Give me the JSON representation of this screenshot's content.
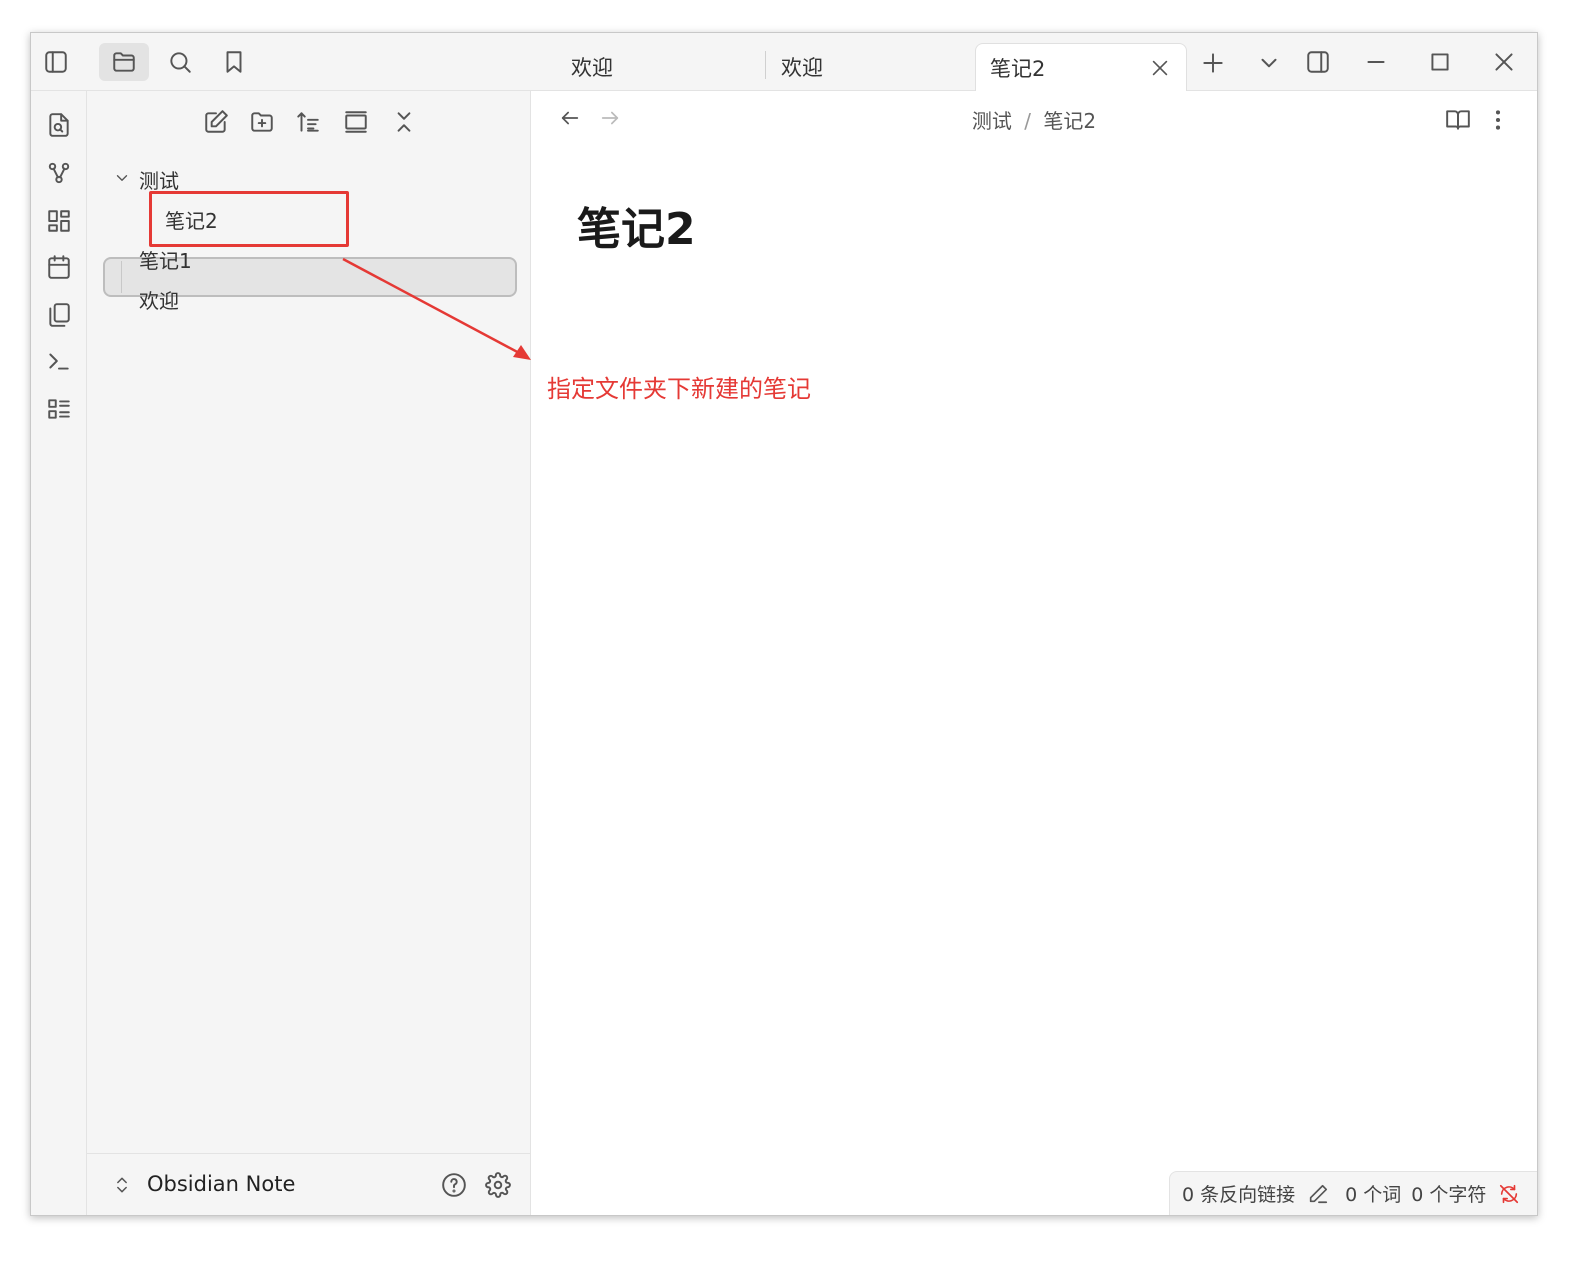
{
  "ribbon": {
    "icons": [
      "file-search-icon",
      "graph-icon",
      "grid-icon",
      "calendar-icon",
      "copy-icon",
      "terminal-icon",
      "list-icon"
    ]
  },
  "sidebar_header": {
    "icons": [
      "sidebar-toggle-icon",
      "folder-icon",
      "search-icon",
      "bookmark-icon"
    ]
  },
  "file_explorer": {
    "toolbar_icons": [
      "new-note-icon",
      "new-folder-icon",
      "sort-icon",
      "collapse-view-icon",
      "collapse-all-icon"
    ],
    "folder": {
      "label": "测试"
    },
    "items": [
      {
        "label": "笔记2"
      },
      {
        "label": "笔记1"
      },
      {
        "label": "欢迎"
      }
    ]
  },
  "vault": {
    "name": "Obsidian Note"
  },
  "tabs": [
    {
      "label": "欢迎"
    },
    {
      "label": "欢迎"
    },
    {
      "label": "笔记2"
    }
  ],
  "breadcrumb": {
    "folder": "测试",
    "separator": "/",
    "note": "笔记2"
  },
  "note": {
    "title": "笔记2"
  },
  "annotation": {
    "text": "指定文件夹下新建的笔记",
    "color": "#e53935"
  },
  "status": {
    "backlinks": "0 条反向链接",
    "words": "0 个词",
    "chars": "0 个字符"
  }
}
